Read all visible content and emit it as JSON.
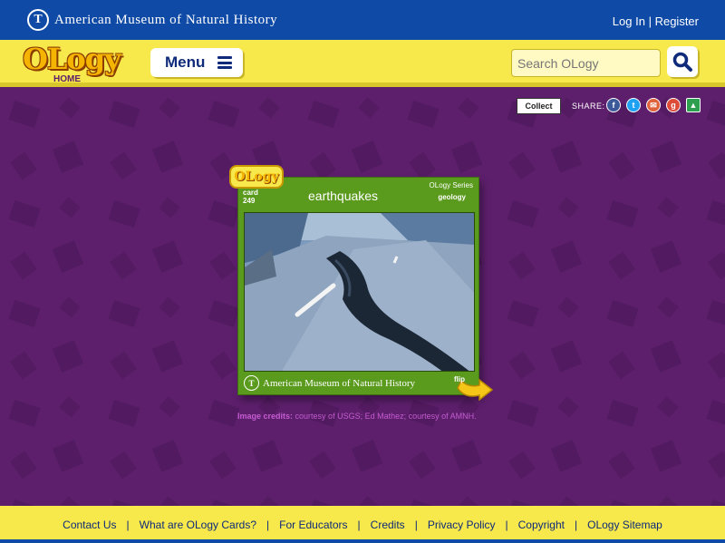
{
  "topbar": {
    "museum_name": "American Museum of Natural History",
    "login": "Log In",
    "divider": "|",
    "register": "Register"
  },
  "header": {
    "logo_word": "OLogy",
    "logo_sub": "HOME",
    "menu_label": "Menu",
    "search_placeholder": "Search OLogy"
  },
  "share": {
    "collect_label": "Collect",
    "share_label": "SHARE:",
    "icons": [
      "facebook-icon",
      "twitter-icon",
      "email-icon",
      "google-plus-icon",
      "classroom-icon"
    ]
  },
  "card": {
    "tab_word": "OLogy",
    "card_label": "card",
    "card_number": "249",
    "title": "earthquakes",
    "series": "OLogy Series",
    "subject": "geology",
    "footer_text": "American Museum of Natural History",
    "flip_label": "flip"
  },
  "credits": {
    "label": "Image credits:",
    "text": "courtesy of USGS; Ed Mathez; courtesy of AMNH."
  },
  "footer": {
    "links": [
      "Contact Us",
      "What are OLogy Cards?",
      "For Educators",
      "Credits",
      "Privacy Policy",
      "Copyright",
      "OLogy Sitemap"
    ]
  },
  "colors": {
    "top_blue": "#0f4aa6",
    "yellow": "#f7e84b",
    "purple": "#5d1f6c",
    "card_green": "#5a9a1c"
  }
}
